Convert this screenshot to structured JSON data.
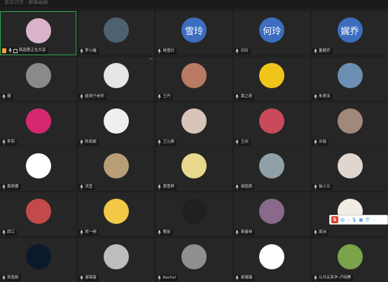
{
  "window": {
    "title": "会议讨论 · 屏幕画廊"
  },
  "participants": [
    {
      "name": "韩国惠正在共享",
      "sharing": true,
      "active": true,
      "avatar": {
        "kind": "image",
        "bg": "#d9b3c9",
        "icon": "flowers-avatar"
      }
    },
    {
      "name": "罗小曦",
      "avatar": {
        "kind": "image",
        "bg": "#4d6270",
        "icon": "landscape-avatar"
      }
    },
    {
      "name": "杨雪玲",
      "avatar": {
        "kind": "text",
        "text": "雪玲"
      }
    },
    {
      "name": "何玲",
      "avatar": {
        "kind": "text",
        "text": "何玲"
      }
    },
    {
      "name": "董娓乔",
      "avatar": {
        "kind": "text",
        "text": "娓乔"
      }
    },
    {
      "name": "捷",
      "avatar": {
        "kind": "image",
        "bg": "#8a8a8a",
        "icon": "cat-avatar"
      }
    },
    {
      "name": "姐琪子老师",
      "more": true,
      "avatar": {
        "kind": "image",
        "bg": "#e6e6e6",
        "icon": "sketch-avatar"
      }
    },
    {
      "name": "王丹",
      "avatar": {
        "kind": "image",
        "bg": "#b87a62",
        "icon": "child-avatar"
      }
    },
    {
      "name": "黄之奇",
      "avatar": {
        "kind": "image",
        "bg": "#f0c419",
        "icon": "cartoon-avatar"
      }
    },
    {
      "name": "朱贤泳",
      "avatar": {
        "kind": "image",
        "bg": "#6b8fb3",
        "icon": "person-avatar"
      }
    },
    {
      "name": "李莉",
      "avatar": {
        "kind": "image",
        "bg": "#d6286e",
        "icon": "black-cat-avatar"
      }
    },
    {
      "name": "陈凯颖",
      "avatar": {
        "kind": "image",
        "bg": "#efefef",
        "icon": "drawing-avatar"
      }
    },
    {
      "name": "王沁卿",
      "avatar": {
        "kind": "image",
        "bg": "#d8c4b8",
        "icon": "baby-avatar"
      }
    },
    {
      "name": "王欣",
      "avatar": {
        "kind": "image",
        "bg": "#c94a5a",
        "icon": "baby2-avatar"
      }
    },
    {
      "name": "许瑞",
      "avatar": {
        "kind": "image",
        "bg": "#a0887a",
        "icon": "tree-avatar"
      }
    },
    {
      "name": "黄妍娜",
      "avatar": {
        "kind": "image",
        "bg": "#ffffff",
        "icon": "location-pin-avatar"
      }
    },
    {
      "name": "洪宜",
      "avatar": {
        "kind": "image",
        "bg": "#b89e77",
        "icon": "interior-avatar"
      }
    },
    {
      "name": "黄雪婷",
      "avatar": {
        "kind": "image",
        "bg": "#e8d98c",
        "icon": "bird-cartoon-avatar"
      }
    },
    {
      "name": "谢国燕",
      "avatar": {
        "kind": "image",
        "bg": "#8fa0a8",
        "icon": "lake-avatar"
      }
    },
    {
      "name": "徐小兰",
      "avatar": {
        "kind": "image",
        "bg": "#e0d6d0",
        "icon": "girl-avatar"
      }
    },
    {
      "name": "西江",
      "avatar": {
        "kind": "image",
        "bg": "#c24a4a",
        "icon": "red-roof-avatar"
      }
    },
    {
      "name": "郑一畅",
      "avatar": {
        "kind": "image",
        "bg": "#f3c847",
        "icon": "yellow-cartoon-avatar"
      }
    },
    {
      "name": "曹前",
      "avatar": {
        "kind": "image",
        "bg": "#202020",
        "icon": "night-avatar"
      }
    },
    {
      "name": "蒋春林",
      "avatar": {
        "kind": "image",
        "bg": "#8a6a8a",
        "icon": "ballet-avatar"
      }
    },
    {
      "name": "周洲",
      "avatar": {
        "kind": "image",
        "bg": "#f0ebe3",
        "icon": "anime-girl-avatar"
      }
    },
    {
      "name": "吴逸新",
      "avatar": {
        "kind": "image",
        "bg": "#0b1a2a",
        "icon": "ring-avatar"
      }
    },
    {
      "name": "谢锦鑫",
      "avatar": {
        "kind": "image",
        "bg": "#bdbdbd",
        "icon": "meme-avatar"
      }
    },
    {
      "name": "Rachel",
      "avatar": {
        "kind": "image",
        "bg": "#8f8f8f",
        "icon": "man-avatar"
      }
    },
    {
      "name": "谢璐璐",
      "avatar": {
        "kind": "image",
        "bg": "#ffffff",
        "icon": "silhouette-avatar"
      }
    },
    {
      "name": "公共关系学-卢晓腾",
      "avatar": {
        "kind": "image",
        "bg": "#7aa34a",
        "icon": "colorful-avatar"
      }
    }
  ],
  "ime_bar": {
    "logo": "S",
    "items": [
      "中",
      "·,",
      "🎙",
      "▦",
      "👕",
      "⋯"
    ]
  },
  "colors": {
    "active_border": "#2fa84f",
    "text_avatar_bg": "#3d6dbf",
    "tile_bg": "#262626",
    "page_bg": "#1e1e1e"
  }
}
